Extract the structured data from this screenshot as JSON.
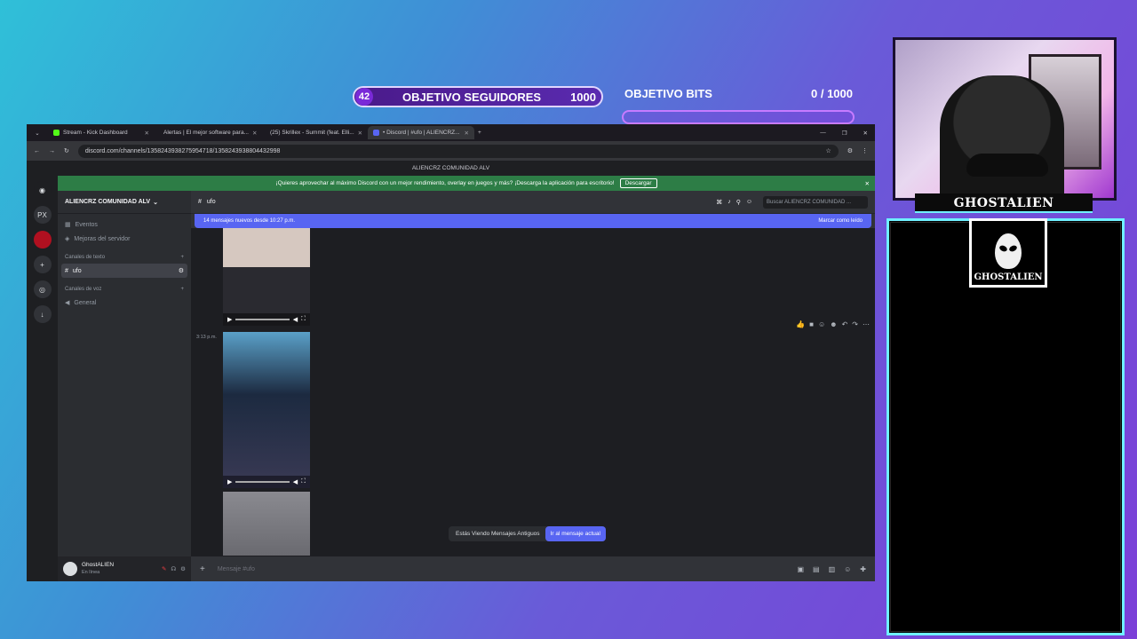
{
  "overlay": {
    "followers_current": "42",
    "followers_label": "OBJETIVO SEGUIDORES",
    "followers_goal": "1000",
    "bits_label": "OBJETIVO BITS",
    "bits_value": "0 / 1000",
    "streamer_name": "GHOSTALIEN",
    "alert_logo_name": "GHOSTALIEN"
  },
  "browser": {
    "tabs": [
      {
        "label": "Stream - Kick Dashboard",
        "color": "#53fc18"
      },
      {
        "label": "Alertas | El mejor software para...",
        "color": "#dddddd"
      },
      {
        "label": "(25) Skrillex - Summit (feat. Elli...",
        "color": "#ff0000"
      },
      {
        "label": "• Discord | #ufo | ALIENCRZ...",
        "color": "#5865f2"
      }
    ],
    "url": "discord.com/channels/1358243938275954718/1358243938804432998"
  },
  "discord": {
    "window_title": "ALIENCRZ COMUNIDAD ALV",
    "banner_text": "¡Quieres aprovechar al máximo Discord con un mejor rendimiento, overlay en juegos y más? ¡Descarga la aplicación para escritorio!",
    "banner_button": "Descargar",
    "guild_px": "PX",
    "server_name": "ALIENCRZ COMUNIDAD ALV",
    "events": "Eventos",
    "boosts": "Mejoras del servidor",
    "text_category": "Canales de texto",
    "active_channel": "ufo",
    "voice_category": "Canales de voz",
    "voice_channel": "General",
    "user_name": "GhostALIEN",
    "user_status": "En línea",
    "channel_header": "ufo",
    "search_placeholder": "Buscar ALIENCRZ COMUNIDAD ...",
    "new_messages": "14 mensajes nuevos desde 10:27 p.m.",
    "mark_read": "Marcar como leído",
    "timestamp": "3:13 p.m.",
    "old_messages": "Estás Viendo Mensajes Antiguos",
    "jump_present": "Ir al mensaje actual",
    "composer_placeholder": "Mensaje #ufo"
  }
}
